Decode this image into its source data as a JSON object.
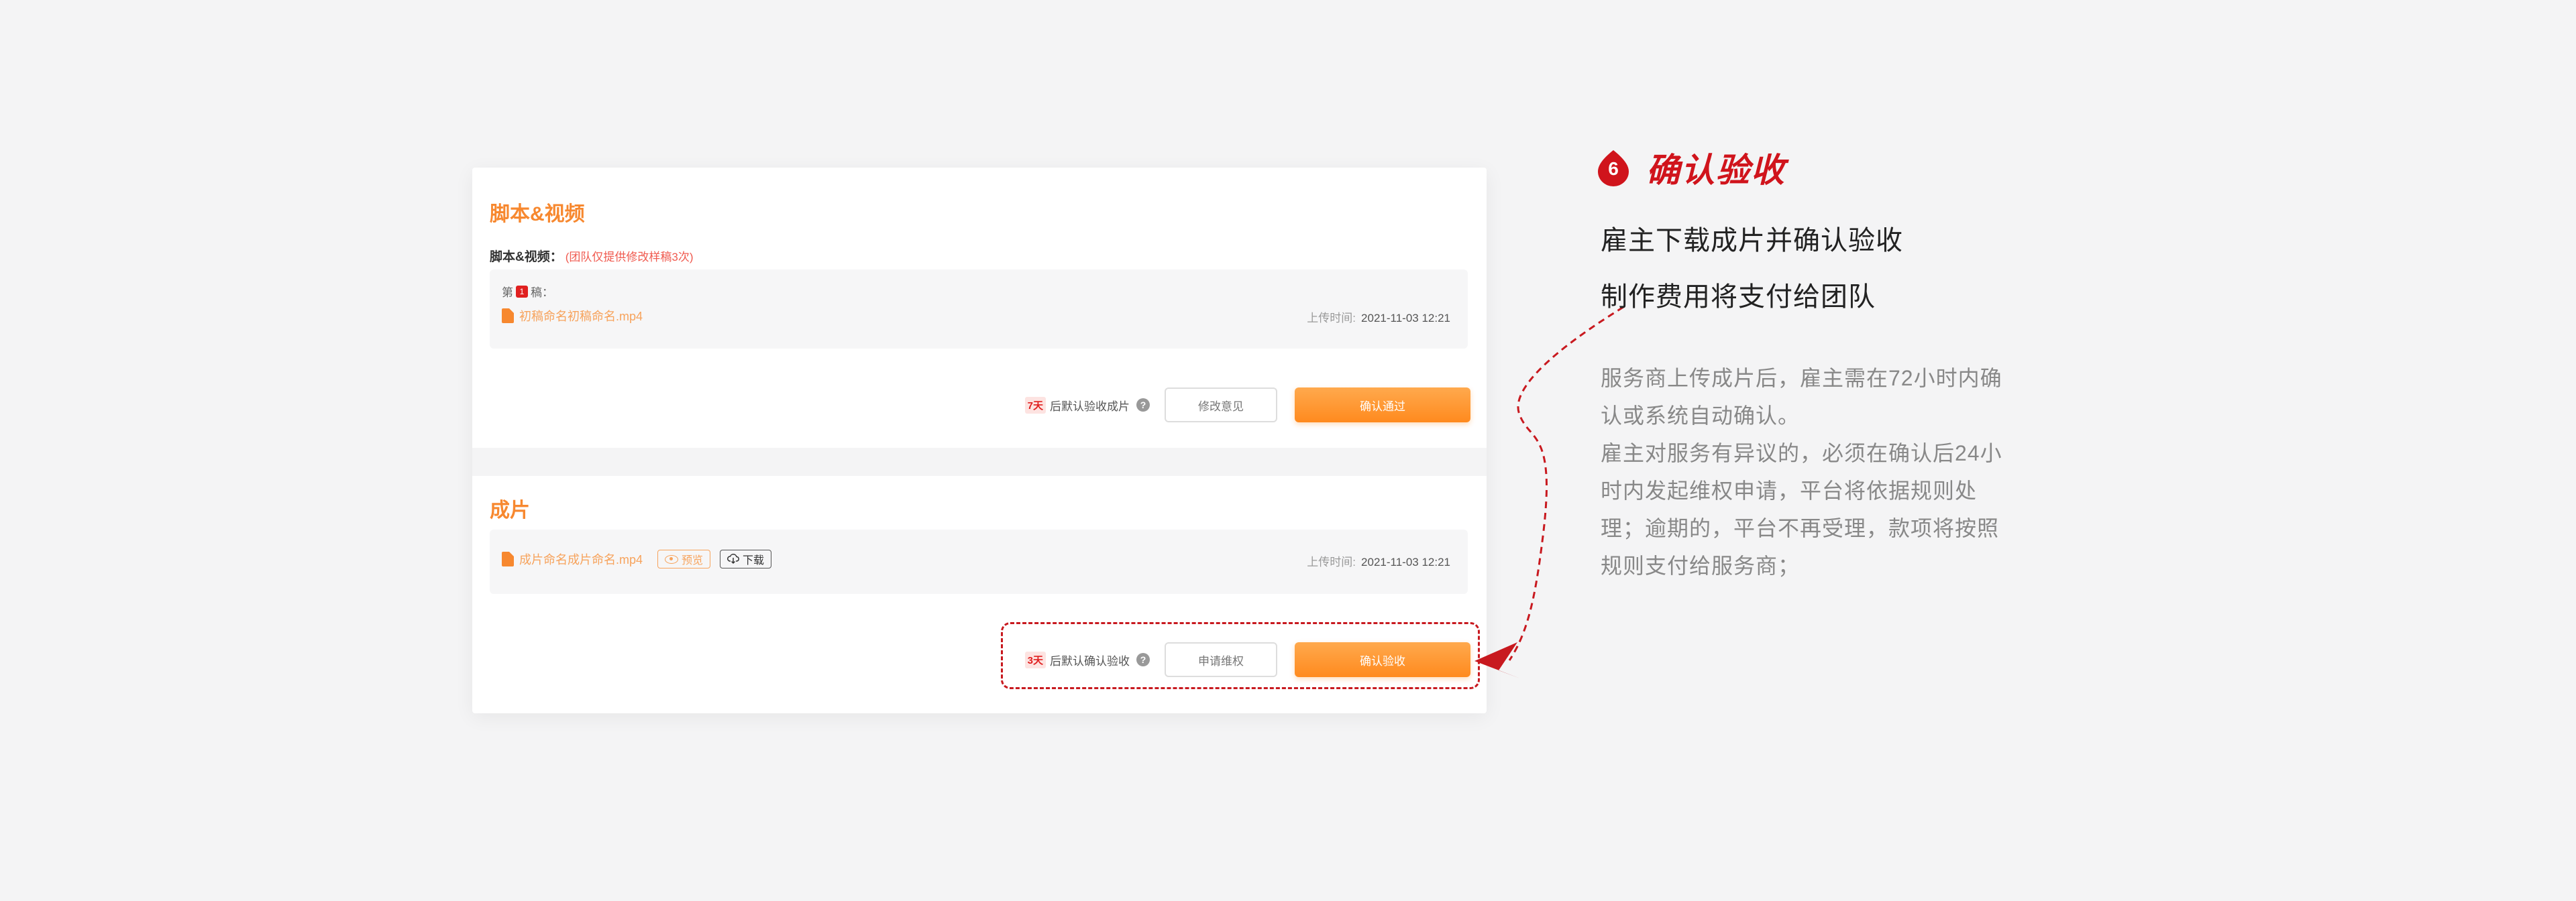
{
  "script_section": {
    "title": "脚本&视频",
    "sub_label": "脚本&视频：",
    "sub_note": "(团队仅提供修改样稿3次)",
    "version_prefix": "第",
    "version_number": "1",
    "version_suffix": "稿：",
    "file_name": "初稿命名初稿命名.mp4",
    "upload_label": "上传时间:",
    "upload_time": "2021-11-03 12:21",
    "days_badge": "7天",
    "auto_text": "后默认验收成片",
    "help": "?",
    "outline_button": "修改意见",
    "primary_button": "确认通过"
  },
  "final_section": {
    "title": "成片",
    "file_name": "成片命名成片命名.mp4",
    "preview_label": "预览",
    "download_label": "下载",
    "upload_label": "上传时间:",
    "upload_time": "2021-11-03 12:21",
    "days_badge": "3天",
    "auto_text": "后默认确认验收",
    "help": "?",
    "outline_button": "申请维权",
    "primary_button": "确认验收"
  },
  "annotation": {
    "step_number": "6",
    "step_title": "确认验收",
    "lead_line_1": "雇主下载成片并确认验收",
    "lead_line_2": "制作费用将支付给团队",
    "desc_1": "服务商上传成片后，雇主需在72小时内确认或系统自动确认。",
    "desc_2": "雇主对服务有异议的，必须在确认后24小时内发起维权申请，平台将依据规则处理；逾期的，平台不再受理，款项将按照规则支付给服务商；"
  },
  "colors": {
    "accent_orange": "#f7882f",
    "accent_red": "#d0141c",
    "highlight_red": "#c8191f"
  }
}
